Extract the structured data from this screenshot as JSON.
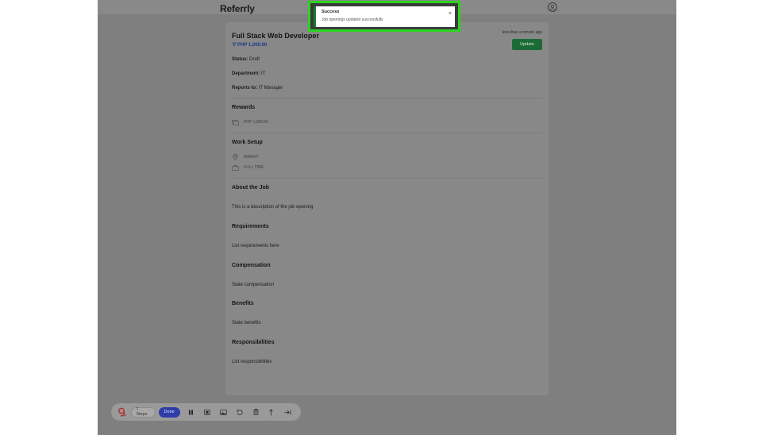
{
  "header": {
    "brand": "Referrly",
    "profile_icon": "user-circle-icon"
  },
  "toast": {
    "title": "Success",
    "message": "Job openings updated successfully",
    "close_label": "×",
    "border_color": "#2bd420"
  },
  "job": {
    "title": "Full Stack Web Developer",
    "salary": "PHP 1,000.00",
    "timestamp": "less than a minute ago",
    "update_label": "Update",
    "status_label": "Status:",
    "status_value": "Draft",
    "department_label": "Department:",
    "department_value": "IT",
    "reports_label": "Reports to:",
    "reports_value": "IT Manager"
  },
  "sections": {
    "rewards": {
      "heading": "Rewards",
      "amount": "PHP 1,000.00"
    },
    "work_setup": {
      "heading": "Work Setup",
      "location": "MAKATI",
      "type": "FULL TIME"
    },
    "about": {
      "heading": "About the Job",
      "text": "This is a description of the job opening"
    },
    "requirements": {
      "heading": "Requirements",
      "text": "List requirements here"
    },
    "compensation": {
      "heading": "Compensation",
      "text": "State compensation"
    },
    "benefits": {
      "heading": "Benefits",
      "text": "State benefits"
    },
    "responsibilities": {
      "heading": "Responsibilities",
      "text": "List responsibilities"
    }
  },
  "recorder": {
    "steps_label": "7 Steps",
    "done_label": "Done",
    "accent": "#2e3da8",
    "icons": [
      "pause-icon",
      "stop-icon",
      "image-icon",
      "undo-icon",
      "trash-icon",
      "share-icon",
      "skip-icon"
    ]
  }
}
